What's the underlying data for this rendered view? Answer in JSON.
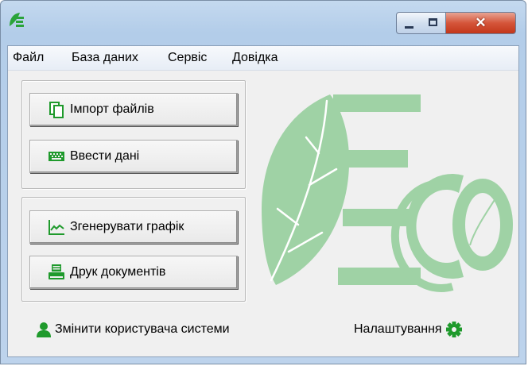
{
  "window": {
    "title": ""
  },
  "menu": {
    "items": [
      "Файл",
      "База даних",
      "Сервіс",
      "Довідка"
    ]
  },
  "buttons": {
    "import": "Імпорт файлів",
    "enter": "Ввести дані",
    "graph": "Згенерувати графік",
    "print": "Друк документів"
  },
  "footer": {
    "change_user": "Змінити користувача системи",
    "settings": "Налаштування"
  },
  "icons": {
    "app": "eco-app-icon",
    "import": "documents-icon",
    "enter": "keyboard-icon",
    "graph": "line-chart-icon",
    "print": "printer-icon",
    "user": "user-icon",
    "settings": "gear-icon"
  },
  "colors": {
    "accent_green": "#1f9a2c",
    "logo_green": "#9fd2a5"
  }
}
